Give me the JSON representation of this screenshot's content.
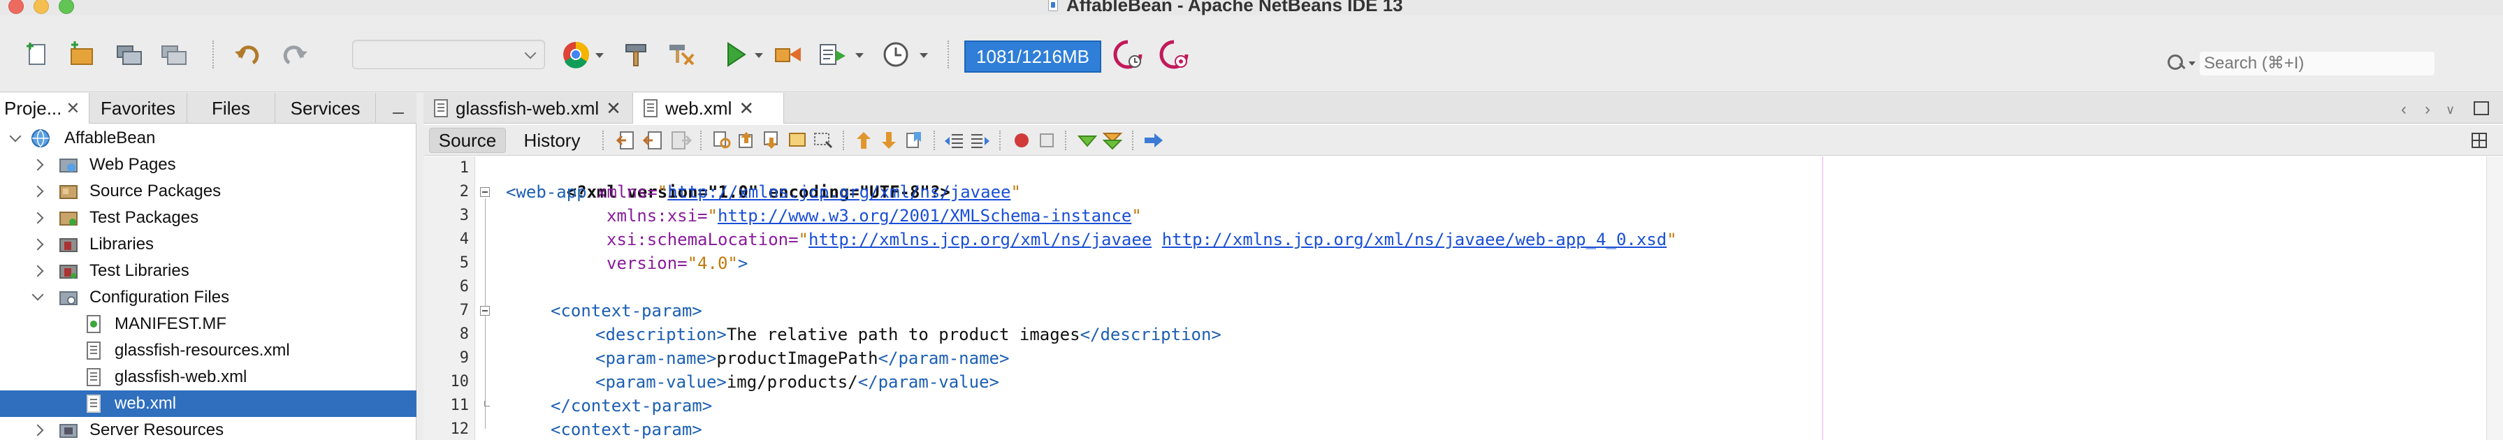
{
  "window": {
    "title": "AffableBean - Apache NetBeans IDE 13"
  },
  "toolbar": {
    "memory": "1081/1216MB",
    "search_placeholder": "Search (⌘+I)",
    "icons": [
      "new-file-icon",
      "new-project-icon",
      "open-project-icon",
      "close-project-icon",
      "undo-icon",
      "redo-icon",
      "browser-chrome-icon",
      "build-hammer-icon",
      "clean-build-icon",
      "run-play-icon",
      "debug-icon",
      "profile-icon",
      "history-clock-icon",
      "profiler-snapshot-icon",
      "profiler-telemetry-icon"
    ]
  },
  "panel_tabs": [
    {
      "label": "Proje...",
      "closable": true
    },
    {
      "label": "Favorites"
    },
    {
      "label": "Files"
    },
    {
      "label": "Services"
    }
  ],
  "tree": [
    {
      "label": "AffableBean",
      "icon": "globe-project-icon"
    },
    {
      "label": "Web Pages",
      "icon": "web-pages-folder-icon"
    },
    {
      "label": "Source Packages",
      "icon": "source-packages-icon"
    },
    {
      "label": "Test Packages",
      "icon": "test-packages-icon"
    },
    {
      "label": "Libraries",
      "icon": "libraries-icon"
    },
    {
      "label": "Test Libraries",
      "icon": "test-libraries-icon"
    },
    {
      "label": "Configuration Files",
      "icon": "config-folder-icon"
    },
    {
      "label": "MANIFEST.MF",
      "icon": "manifest-file-icon"
    },
    {
      "label": "glassfish-resources.xml",
      "icon": "xml-file-icon"
    },
    {
      "label": "glassfish-web.xml",
      "icon": "xml-file-icon"
    },
    {
      "label": "web.xml",
      "icon": "xml-file-icon",
      "selected": true
    },
    {
      "label": "Server Resources",
      "icon": "server-resources-icon"
    }
  ],
  "editor_tabs": [
    {
      "label": "glassfish-web.xml",
      "closable": true
    },
    {
      "label": "web.xml",
      "closable": true,
      "active": true
    }
  ],
  "editor_subtabs": {
    "source": "Source",
    "history": "History"
  },
  "line_numbers": [
    "1",
    "2",
    "3",
    "4",
    "5",
    "6",
    "7",
    "8",
    "9",
    "10",
    "11",
    "12"
  ],
  "code": {
    "l1": {
      "decl": "<?xml version=\"1.0\" encoding=\"UTF-8\"?>"
    },
    "l2": {
      "tag": "<web-app",
      "attr": " xmlns=",
      "q1": "\"",
      "link": "http://xmlns.jcp.org/xml/ns/javaee",
      "q2": "\""
    },
    "l3": {
      "attr": "xmlns:xsi=",
      "q1": "\"",
      "link": "http://www.w3.org/2001/XMLSchema-instance",
      "q2": "\""
    },
    "l4": {
      "attr": "xsi:schemaLocation=",
      "q1": "\"",
      "link1": "http://xmlns.jcp.org/xml/ns/javaee",
      "sp": " ",
      "link2": "http://xmlns.jcp.org/xml/ns/javaee/web-app_4_0.xsd",
      "q2": "\""
    },
    "l5": {
      "attr": "version=",
      "val": "\"4.0\"",
      "tag": ">"
    },
    "l7": {
      "tag": "<context-param>"
    },
    "l8": {
      "open": "<description>",
      "text": "The relative path to product images",
      "close": "</description>"
    },
    "l9": {
      "open": "<param-name>",
      "text": "productImagePath",
      "close": "</param-name>"
    },
    "l10": {
      "open": "<param-value>",
      "text": "img/products/",
      "close": "</param-value>"
    },
    "l11": {
      "tag": "</context-param>"
    },
    "l12": {
      "tag": "<context-param>"
    }
  }
}
